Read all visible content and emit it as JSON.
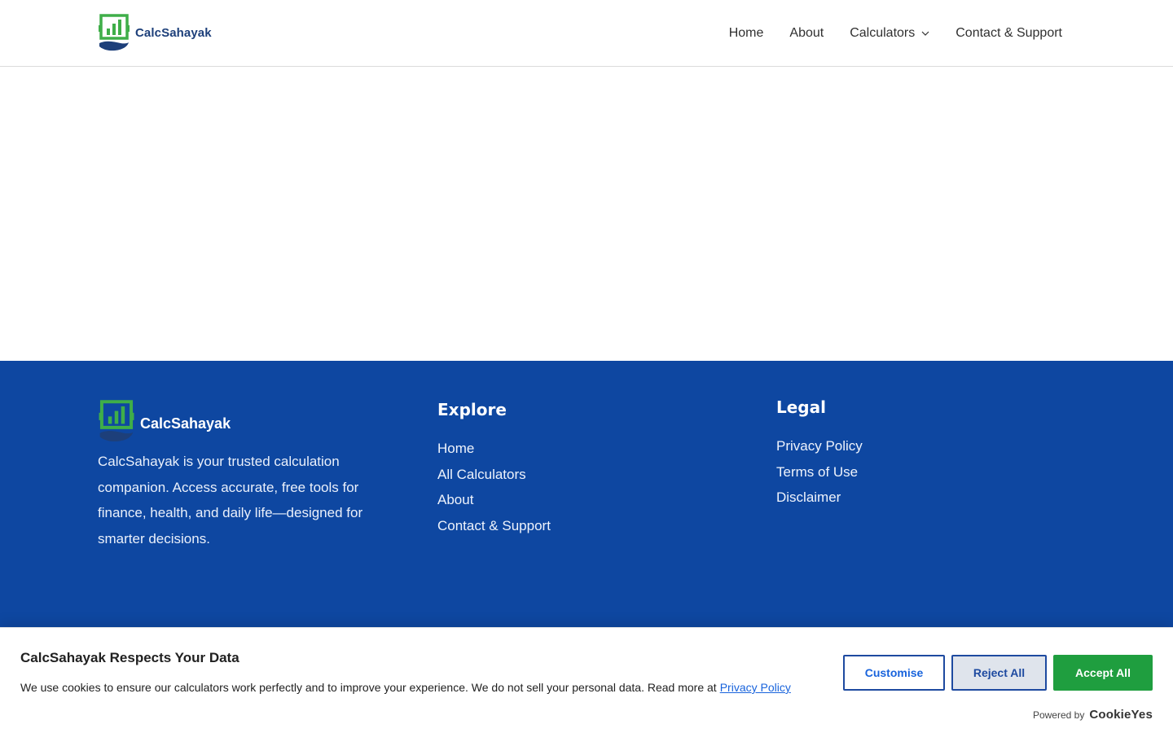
{
  "header": {
    "logo_text": "CalcSahayak",
    "nav": [
      {
        "label": "Home"
      },
      {
        "label": "About"
      },
      {
        "label": "Calculators",
        "has_dropdown": true
      },
      {
        "label": "Contact & Support"
      }
    ]
  },
  "footer": {
    "brand": {
      "logo_text": "CalcSahayak",
      "description": "CalcSahayak is your trusted calculation companion. Access accurate, free tools for finance, health, and daily life—designed for smarter decisions."
    },
    "explore": {
      "heading": "Explore",
      "links": [
        "Home",
        "All Calculators",
        "About",
        "Contact & Support"
      ]
    },
    "legal": {
      "heading": "Legal",
      "links": [
        "Privacy Policy",
        "Terms of Use",
        "Disclaimer"
      ]
    }
  },
  "cookie": {
    "title": "CalcSahayak Respects Your Data",
    "text": "We use cookies to ensure our calculators work perfectly and to improve your experience. We do not sell your personal data. Read more at",
    "policy_link": "Privacy Policy",
    "customise_label": "Customise",
    "reject_label": "Reject All",
    "accept_label": "Accept All",
    "powered_by": "Powered by",
    "powered_brand": "CookieYes"
  },
  "colors": {
    "footer_bg": "#0e47a1",
    "brand_green": "#3fae49",
    "brand_navy": "#1d3f7a",
    "accept_green": "#1f9e3f",
    "link_blue": "#1863dc"
  },
  "icons": {
    "logo": "bar-chart-hand-logo-icon",
    "dropdown": "chevron-down-icon"
  }
}
